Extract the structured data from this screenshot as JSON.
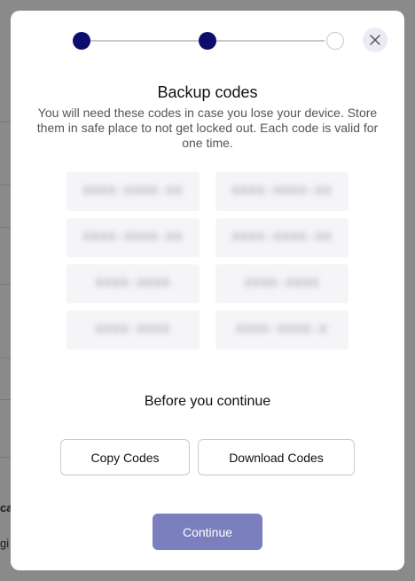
{
  "background": {
    "partial_text_1": "ca",
    "partial_text_2": "gi"
  },
  "stepper": {
    "steps": [
      {
        "state": "complete"
      },
      {
        "state": "complete"
      },
      {
        "state": "pending"
      }
    ],
    "active_color": "#0d0d6b",
    "inactive_color": "#c7c7cf"
  },
  "dialog": {
    "title": "Backup codes",
    "description": "You will need these codes in case you lose your device. Store them in safe place to not get locked out. Each code is valid for one time.",
    "codes": [
      "XXXX-XXXX-XX",
      "XXXX-XXXX-XX",
      "XXXX-XXXX-XX",
      "XXXX-XXXX-XX",
      "XXXX-XXXX",
      "XXXX-XXXX",
      "XXXX-XXXX",
      "XXXX-XXXX-X"
    ],
    "subtitle": "Before you continue",
    "copy_label": "Copy Codes",
    "download_label": "Download Codes",
    "continue_label": "Continue",
    "close_icon": "close-icon",
    "primary_color": "#7b7fbd"
  }
}
